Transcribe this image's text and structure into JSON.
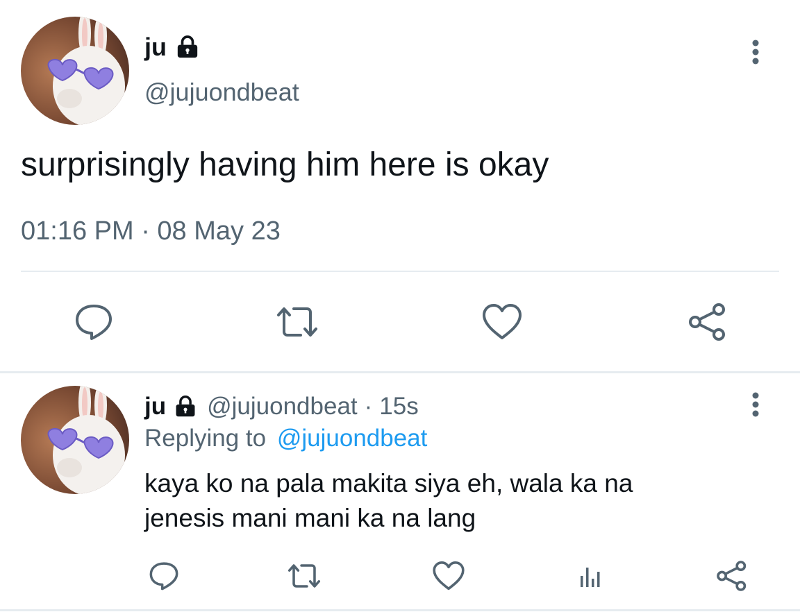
{
  "main_tweet": {
    "display_name": "ju",
    "handle": "@jujuondbeat",
    "text": "surprisingly having him here is okay",
    "timestamp": "01:16 PM · 08 May 23",
    "icons": {
      "protected": "lock-icon",
      "more": "more-vertical-icon",
      "reply": "reply-icon",
      "retweet": "retweet-icon",
      "like": "like-icon",
      "share": "share-icon"
    }
  },
  "reply_tweet": {
    "display_name": "ju",
    "handle": "@jujuondbeat",
    "separator": "·",
    "time_ago": "15s",
    "replying_to_label": "Replying to",
    "replying_to_handle": "@jujuondbeat",
    "text_line1": "kaya ko na pala makita siya eh, wala ka na",
    "text_line2": "jenesis mani mani ka na lang",
    "icons": {
      "protected": "lock-icon",
      "more": "more-vertical-icon",
      "reply": "reply-icon",
      "retweet": "retweet-icon",
      "like": "like-icon",
      "analytics": "analytics-icon",
      "share": "share-icon"
    }
  },
  "colors": {
    "text": "#0f1419",
    "secondary": "#536471",
    "link": "#1d9bf0",
    "divider": "#e6ecf0",
    "icon": "#536471"
  }
}
